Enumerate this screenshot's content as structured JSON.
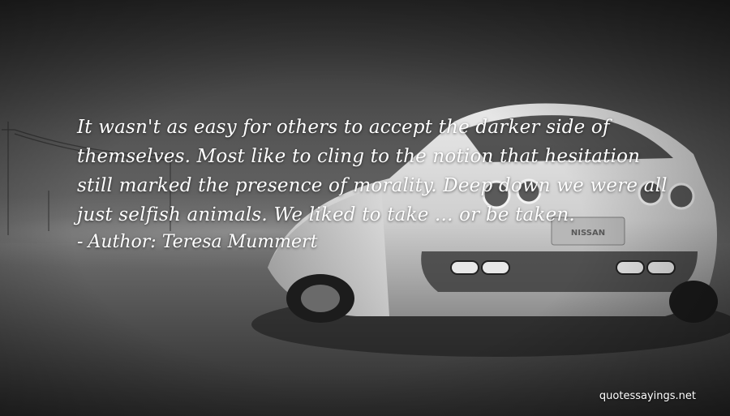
{
  "quote": {
    "text": "It wasn't as easy for others to accept the darker side of themselves. Most like to cling to the notion that hesitation still marked the presence of morality. Deep down we were all just selfish animals. We liked to take ... or be taken."
  },
  "attribution": {
    "dash": "-",
    "label": "Author:",
    "name": "Teresa Mummert"
  },
  "watermark": {
    "text": "quotessayings.net"
  },
  "car_badge": {
    "text": "NISSAN"
  }
}
